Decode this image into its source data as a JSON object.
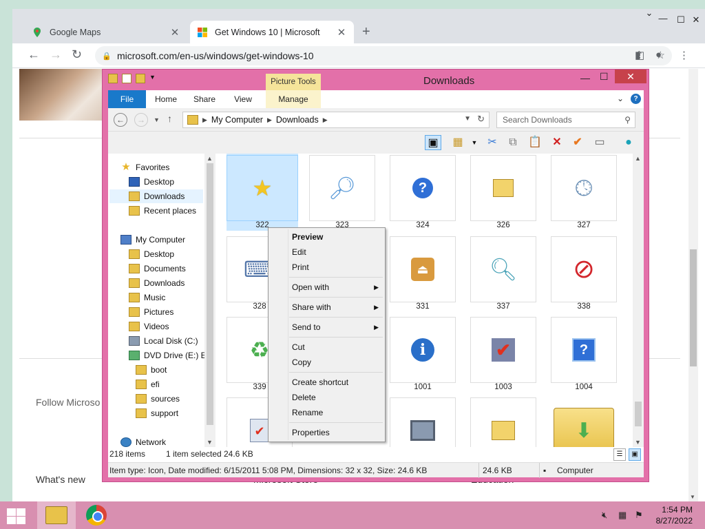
{
  "browser": {
    "tabs": [
      {
        "title": "Google Maps",
        "favicon": "google-maps-icon"
      },
      {
        "title": "Get Windows 10 | Microsoft",
        "favicon": "microsoft-icon"
      }
    ],
    "new_tab_symbol": "+",
    "url": "microsoft.com/en-us/windows/get-windows-10"
  },
  "page": {
    "follow_text": "Follow Microso",
    "whats_new": "What's new",
    "microsoft_store": "Microsoft Store",
    "education": "Education"
  },
  "explorer": {
    "title": "Downloads",
    "picture_tools": "Picture Tools",
    "ribbon_tabs": [
      "File",
      "Home",
      "Share",
      "View",
      "Manage"
    ],
    "breadcrumb": [
      "My Computer",
      "Downloads"
    ],
    "search_placeholder": "Search Downloads",
    "nav": {
      "favorites": "Favorites",
      "fav_items": [
        "Desktop",
        "Downloads",
        "Recent places"
      ],
      "my_computer": "My Computer",
      "pc_items": [
        "Desktop",
        "Documents",
        "Downloads",
        "Music",
        "Pictures",
        "Videos",
        "Local Disk (C:)",
        "DVD Drive (E:) ES"
      ],
      "dvd_items": [
        "boot",
        "efi",
        "sources",
        "support"
      ],
      "network": "Network"
    },
    "files": [
      {
        "name": "322",
        "icon": "star-icon"
      },
      {
        "name": "323",
        "icon": "magnifier-icon"
      },
      {
        "name": "324",
        "icon": "help-icon"
      },
      {
        "name": "326",
        "icon": "folder-grid-icon"
      },
      {
        "name": "327",
        "icon": "clock-icon"
      },
      {
        "name": "328",
        "icon": "keyboard-icon"
      },
      {
        "name": "331",
        "icon": "eject-icon"
      },
      {
        "name": "337",
        "icon": "scanner-icon"
      },
      {
        "name": "338",
        "icon": "prohibited-icon"
      },
      {
        "name": "339",
        "icon": "recycle-clock-icon"
      },
      {
        "name": "1001",
        "icon": "info-icon"
      },
      {
        "name": "1003",
        "icon": "checkmark-icon"
      },
      {
        "name": "1004",
        "icon": "help-window-icon"
      },
      {
        "name": "",
        "icon": "check-doc-icon"
      },
      {
        "name": "",
        "icon": "computer-icon"
      },
      {
        "name": "",
        "icon": "network-folder-icon"
      },
      {
        "name": "",
        "icon": "download-folder-icon"
      }
    ],
    "status": {
      "items": "218 items",
      "selected": "1 item selected",
      "size": "24.6 KB"
    },
    "details": {
      "info": "Item type: Icon, Date modified: 6/15/2011 5:08 PM, Dimensions: 32 x 32, Size: 24.6 KB",
      "size": "24.6 KB",
      "location": "Computer"
    }
  },
  "context_menu": {
    "items": [
      "Preview",
      "Edit",
      "Print",
      "Open with",
      "Share with",
      "Send to",
      "Cut",
      "Copy",
      "Create shortcut",
      "Delete",
      "Rename",
      "Properties"
    ]
  },
  "taskbar": {
    "time": "1:54 PM",
    "date": "8/27/2022"
  },
  "colors": {
    "explorer_frame": "#e370a9",
    "taskbar": "#d88fb0",
    "file_tab": "#1979ca",
    "close_button": "#c7424b",
    "selection": "#cce8ff"
  }
}
